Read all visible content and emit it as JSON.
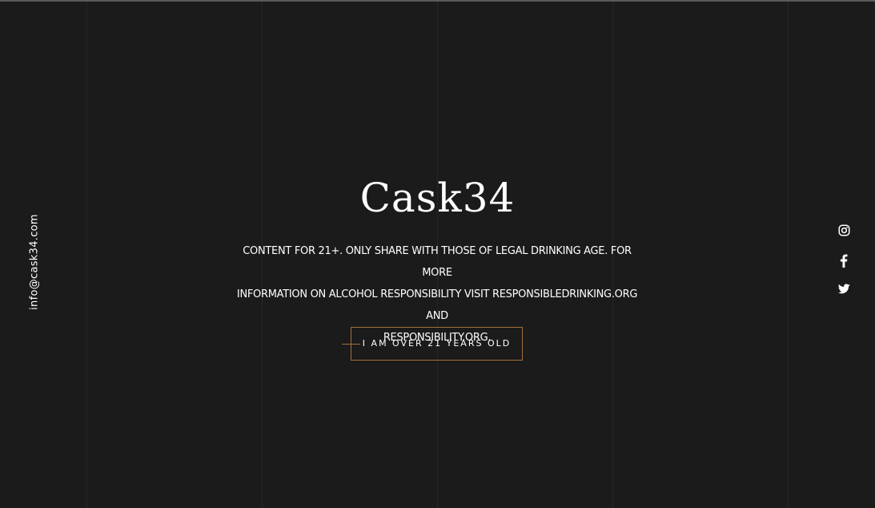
{
  "contact": {
    "email": "info@cask34.com"
  },
  "brand": {
    "logo_text": "Cask34"
  },
  "age_gate": {
    "notice_lines": [
      "CONTENT FOR 21+. ONLY SHARE WITH THOSE OF LEGAL DRINKING AGE. FOR MORE",
      "INFORMATION ON ALCOHOL RESPONSIBILITY VISIT RESPONSIBLEDRINKING.ORG AND",
      "RESPONSIBILITY.ORG."
    ],
    "confirm_button_label": "I AM OVER 21 YEARS OLD"
  },
  "social": {
    "items": [
      {
        "icon": "instagram-icon"
      },
      {
        "icon": "facebook-icon"
      },
      {
        "icon": "twitter-icon"
      }
    ]
  },
  "colors": {
    "background": "#1b1b1b",
    "accent": "#a2703a",
    "text": "#ffffff",
    "grid_line": "#262626"
  }
}
